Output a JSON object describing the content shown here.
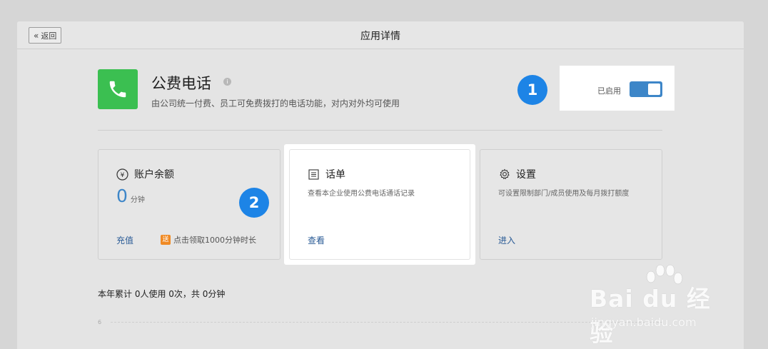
{
  "header": {
    "back_label": "返回",
    "title": "应用详情"
  },
  "app": {
    "name": "公费电话",
    "description": "由公司统一付费、员工可免费拨打的电话功能，对内对外均可使用",
    "icon": "phone-icon",
    "icon_color": "#3bbf51"
  },
  "toggle": {
    "label": "已启用",
    "enabled": true,
    "color": "#3d86c8"
  },
  "badges": [
    "1",
    "2"
  ],
  "cards": {
    "balance": {
      "title": "账户余额",
      "icon": "yen-icon",
      "value": "0",
      "unit": "分钟",
      "action": "充值",
      "promo_tag": "送",
      "promo_text": "点击领取1000分钟时长"
    },
    "bill": {
      "title": "话单",
      "icon": "list-icon",
      "description": "查看本企业使用公费电话通话记录",
      "action": "查看"
    },
    "settings": {
      "title": "设置",
      "icon": "gear-icon",
      "description": "可设置限制部门/成员使用及每月拨打额度",
      "action": "进入"
    }
  },
  "summary": "本年累计 0人使用 0次，共 0分钟",
  "chart_axis_tick": "6",
  "watermark": {
    "brand": "Bai du 经验",
    "url": "jingyan.baidu.com"
  }
}
